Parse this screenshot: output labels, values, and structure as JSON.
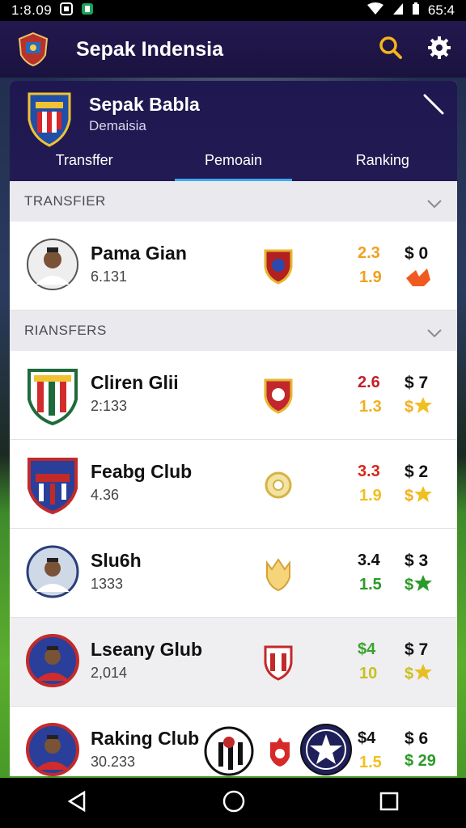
{
  "status": {
    "time": "1:8.09",
    "battery": "65:4"
  },
  "app": {
    "title": "Sepak Indensia"
  },
  "header": {
    "title": "Sepak Babla",
    "subtitle": "Demaisia"
  },
  "tabs": [
    {
      "label": "Transffer",
      "active": false
    },
    {
      "label": "Pemoain",
      "active": true
    },
    {
      "label": "Ranking",
      "active": false
    }
  ],
  "sections": {
    "transfer": "TRANSFIER",
    "transfers": "RIANSFERS"
  },
  "rows": [
    {
      "name": "Pama Gian",
      "code": "6.131",
      "s1": "2.3",
      "s1_color": "#f0a020",
      "s2": "1.9",
      "s2_color": "#f0a020",
      "p1": "$ 0",
      "p2": "",
      "p2_color": "#f05a20"
    },
    {
      "name": "Cliren Glii",
      "code": "2:133",
      "s1": "2.6",
      "s1_color": "#c81e2a",
      "s2": "1.3",
      "s2_color": "#f0b020",
      "p1": "$ 7",
      "p2": "$",
      "p2_color": "#f0b020"
    },
    {
      "name": "Feabg Club",
      "code": "4.36",
      "s1": "3.3",
      "s1_color": "#d4281a",
      "s2": "1.9",
      "s2_color": "#f0c020",
      "p1": "$ 2",
      "p2": "$",
      "p2_color": "#f0b020"
    },
    {
      "name": "Slu6h",
      "code": "1333",
      "s1": "3.4",
      "s1_color": "#111111",
      "s2": "1.5",
      "s2_color": "#2a9a2a",
      "p1": "$ 3",
      "p2": "$",
      "p2_color": "#2a9a2a"
    },
    {
      "name": "Lseany Glub",
      "code": "2,014",
      "s1": "$4",
      "s1_color": "#3aa32a",
      "s2": "10",
      "s2_color": "#c8c020",
      "p1": "$ 7",
      "p2": "$",
      "p2_color": "#c8c020"
    },
    {
      "name": "Raking Club",
      "code": "30.233",
      "s1": "$4",
      "s1_color": "#111111",
      "s2": "1.5",
      "s2_color": "#f0c020",
      "p1": "$ 6",
      "p2": "$ 29",
      "p2_color": "#2a9a2a"
    }
  ],
  "colors": {
    "appbar": "#1a1340",
    "tab_indicator": "#3fa9f5"
  }
}
